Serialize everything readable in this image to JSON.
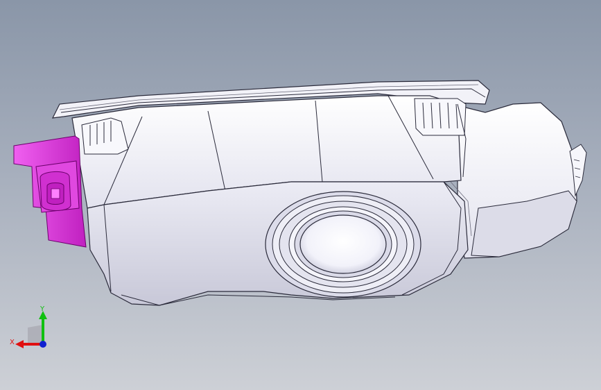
{
  "viewport": {
    "background_top": "#8a96a8",
    "background_bottom": "#cdd0d6"
  },
  "model": {
    "body_color": "#f4f4fa",
    "shadow_color": "#c9c9d6",
    "edge_color": "#2a2a3a",
    "connector_color": "#e040e0"
  },
  "triad": {
    "x_label": "X",
    "y_label": "Y",
    "x_color": "#e01010",
    "y_color": "#10c010",
    "z_color": "#1020d0"
  }
}
